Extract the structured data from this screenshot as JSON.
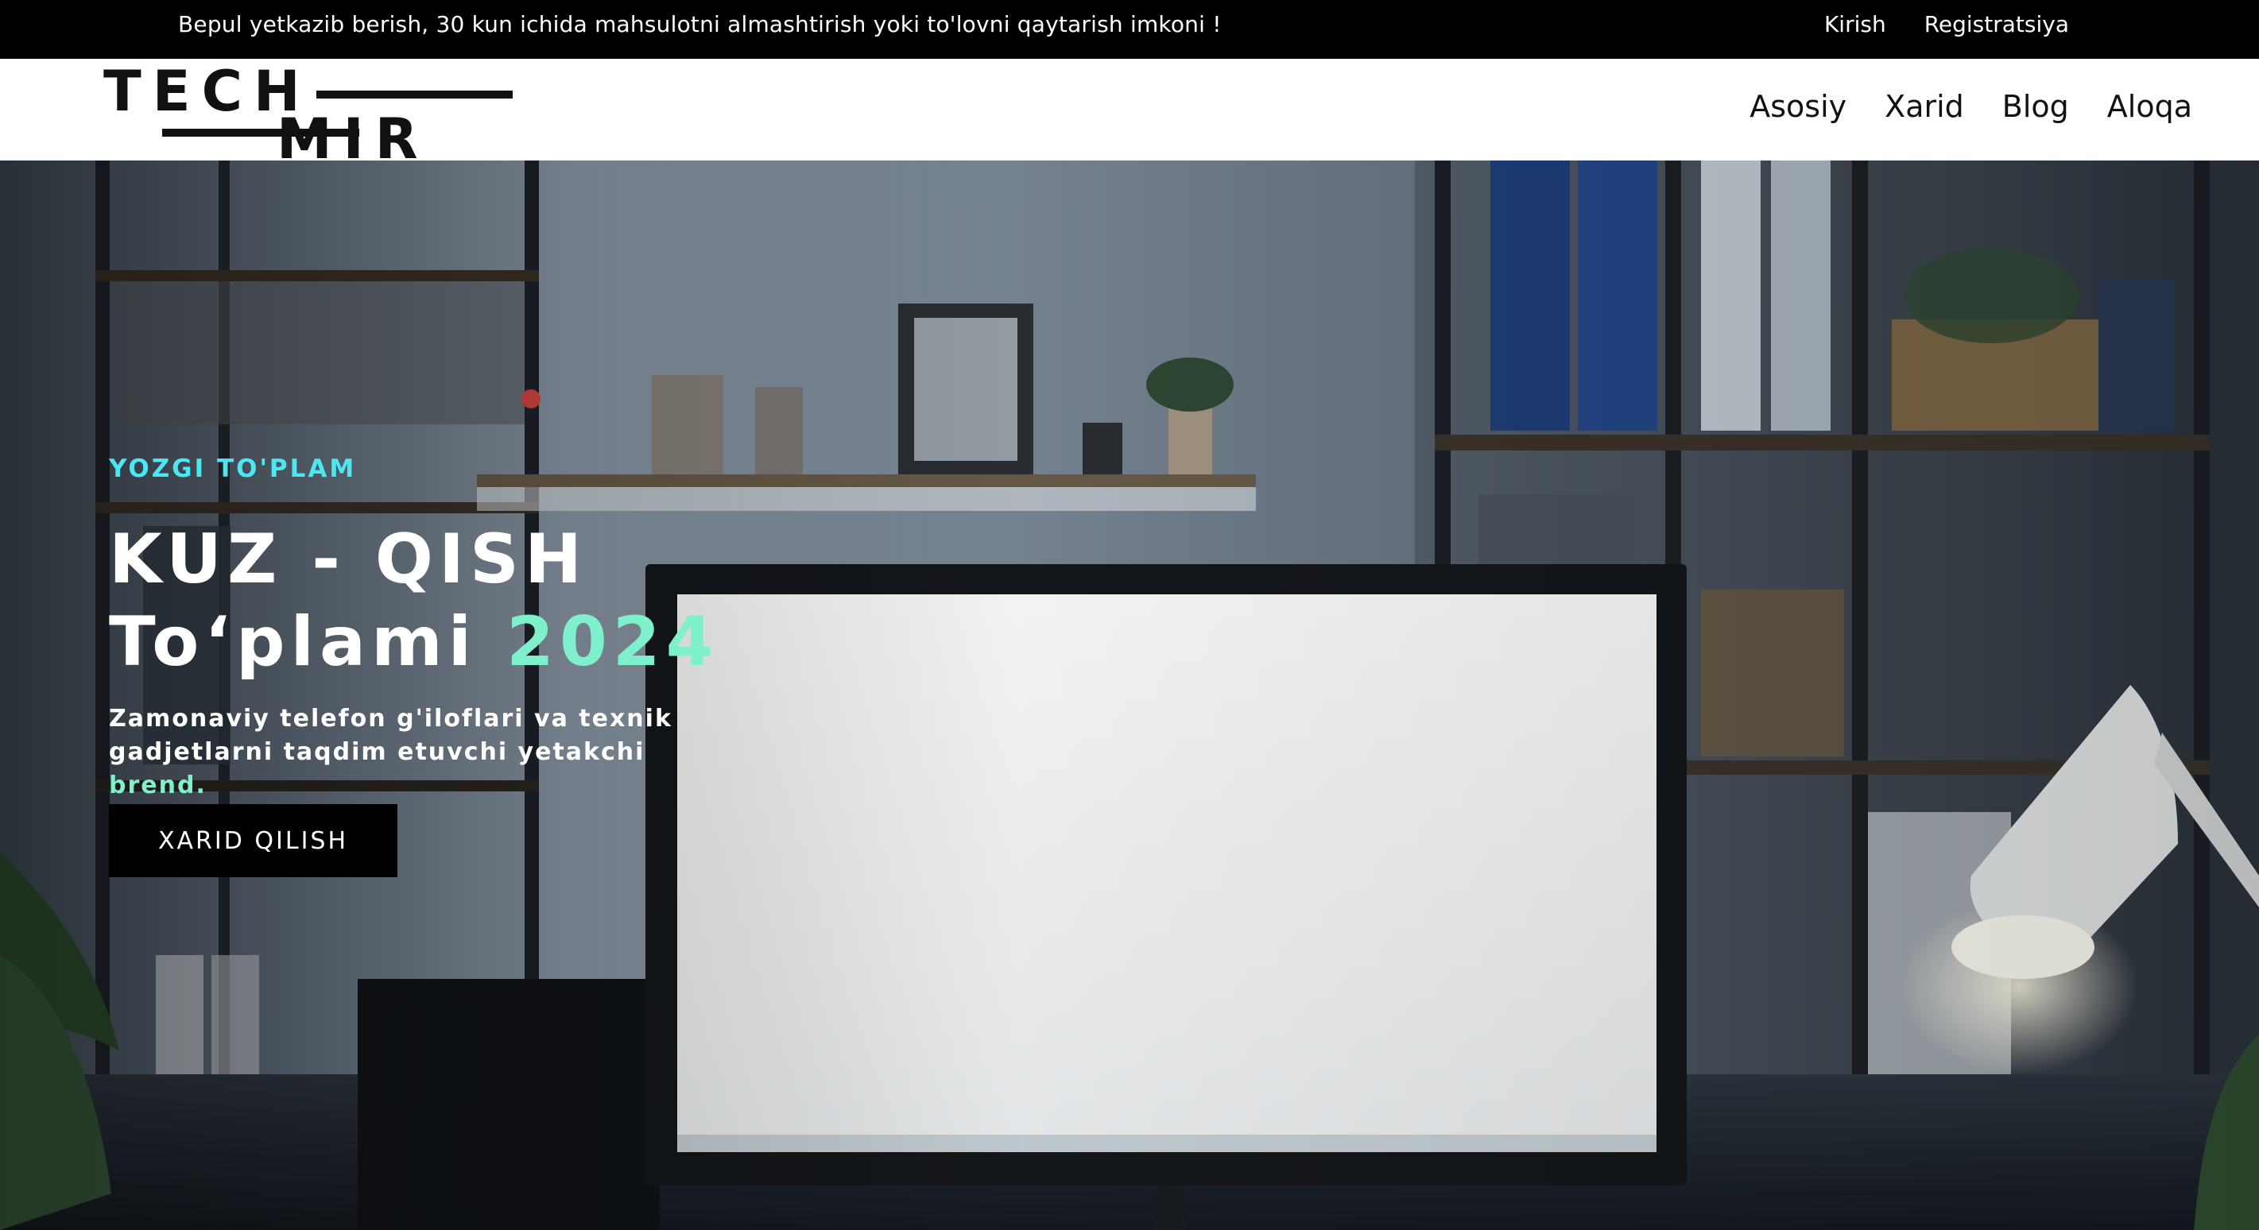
{
  "topbar": {
    "promo_text": "Bepul yetkazib berish, 30 kun ichida mahsulotni almashtirish yoki to'lovni qaytarish imkoni !",
    "login_link": "Kirish",
    "register_link": "Registratsiya"
  },
  "logo": {
    "line1": "TECH",
    "line2": "MIR"
  },
  "nav": {
    "items": [
      "Asosiy",
      "Xarid",
      "Blog",
      "Aloqa"
    ]
  },
  "hero": {
    "eyebrow": "YOZGI TO'PLAM",
    "title_line1": "KUZ - QISH",
    "title_line2_prefix": "To‘plami ",
    "title_year": "2024",
    "subtitle_main": "Zamonaviy telefon g'iloflari va texnik gadjetlarni taqdim etuvchi yetakchi ",
    "subtitle_accent": "brend.",
    "cta_label": "XARID QILISH"
  },
  "colors": {
    "accent_cyan": "#4ee6f0",
    "accent_mint": "#7ef0cc",
    "topbar_bg": "#000000",
    "header_bg": "#ffffff"
  }
}
